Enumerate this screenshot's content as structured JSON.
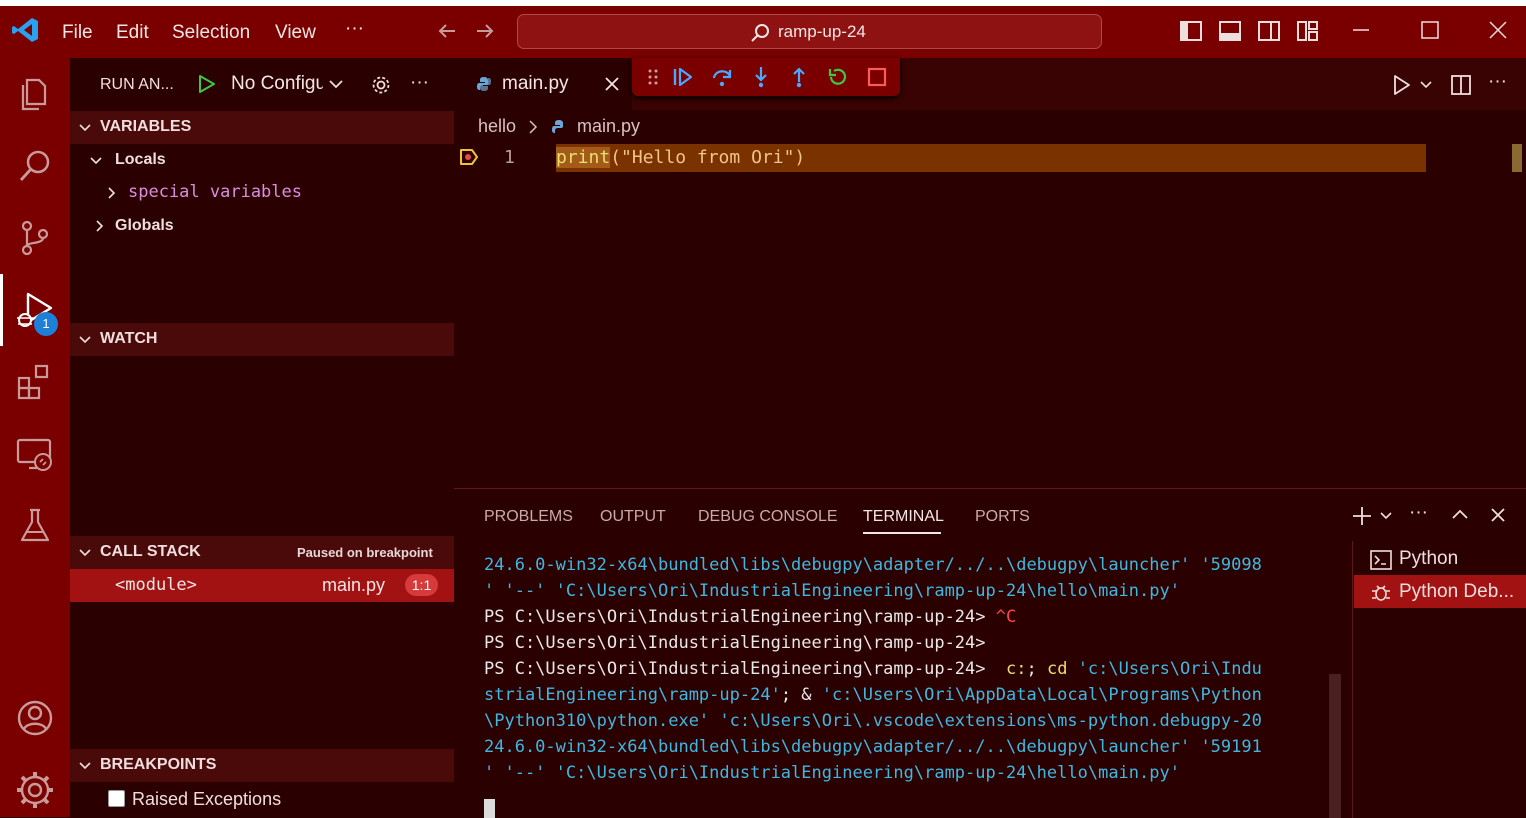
{
  "titlebar": {
    "menu": [
      "File",
      "Edit",
      "Selection",
      "View",
      "···"
    ],
    "search": "ramp-up-24"
  },
  "activitybar": {
    "debug_badge": "1"
  },
  "sidebar": {
    "header_title": "RUN AN...",
    "config_label": "No Configu",
    "variables": {
      "title": "VARIABLES",
      "locals": "Locals",
      "special": "special variables",
      "globals": "Globals"
    },
    "watch": {
      "title": "WATCH"
    },
    "callstack": {
      "title": "CALL STACK",
      "status": "Paused on breakpoint",
      "frame_name": "<module>",
      "frame_file": "main.py",
      "frame_pos": "1:1"
    },
    "breakpoints": {
      "title": "BREAKPOINTS",
      "raised": "Raised Exceptions"
    }
  },
  "editor": {
    "tab_label": "main.py",
    "breadcrumb_folder": "hello",
    "breadcrumb_file": "main.py",
    "line_number": "1",
    "code_fn": "print",
    "code_rest": "(\"Hello from Ori\")"
  },
  "panel": {
    "tabs": [
      "PROBLEMS",
      "OUTPUT",
      "DEBUG CONSOLE",
      "TERMINAL",
      "PORTS"
    ],
    "active_tab": "TERMINAL",
    "terminals": [
      "Python",
      "Python Deb..."
    ],
    "lines": [
      [
        {
          "c": "cyan",
          "t": "24.6.0-win32-x64\\bundled\\libs\\debugpy\\adapter/../..\\debugpy\\launcher' '59098"
        }
      ],
      [
        {
          "c": "cyan",
          "t": "' '--' 'C:\\Users\\Ori\\IndustrialEngineering\\ramp-up-24\\hello\\main.py'"
        }
      ],
      [
        {
          "c": "white",
          "t": "PS C:\\Users\\Ori\\IndustrialEngineering\\ramp-up-24> "
        },
        {
          "c": "red",
          "t": "^C"
        }
      ],
      [
        {
          "c": "white",
          "t": "PS C:\\Users\\Ori\\IndustrialEngineering\\ramp-up-24>"
        }
      ],
      [
        {
          "c": "white",
          "t": "PS C:\\Users\\Ori\\IndustrialEngineering\\ramp-up-24>  "
        },
        {
          "c": "yellow",
          "t": "c:"
        },
        {
          "c": "white",
          "t": "; "
        },
        {
          "c": "yellow",
          "t": "cd"
        },
        {
          "c": "white",
          "t": " "
        },
        {
          "c": "cyan",
          "t": "'c:\\Users\\Ori\\Indu"
        }
      ],
      [
        {
          "c": "cyan",
          "t": "strialEngineering\\ramp-up-24'"
        },
        {
          "c": "white",
          "t": "; & "
        },
        {
          "c": "cyan",
          "t": "'c:\\Users\\Ori\\AppData\\Local\\Programs\\Python"
        }
      ],
      [
        {
          "c": "cyan",
          "t": "\\Python310\\python.exe' 'c:\\Users\\Ori\\.vscode\\extensions\\ms-python.debugpy-20"
        }
      ],
      [
        {
          "c": "cyan",
          "t": "24.6.0-win32-x64\\bundled\\libs\\debugpy\\adapter/../..\\debugpy\\launcher' '59191"
        }
      ],
      [
        {
          "c": "cyan",
          "t": "' '--' 'C:\\Users\\Ori\\IndustrialEngineering\\ramp-up-24\\hello\\main.py'"
        }
      ]
    ]
  }
}
